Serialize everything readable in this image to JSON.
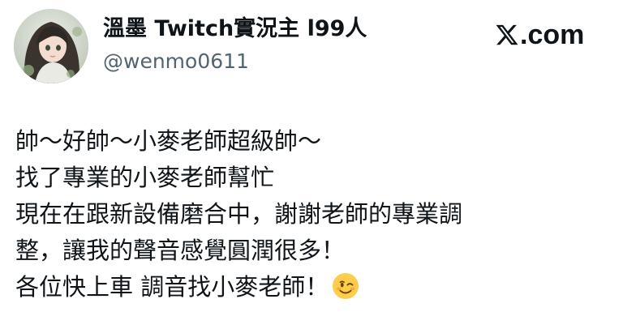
{
  "author": {
    "display_name": "溫墨 Twitch實況主 l99人",
    "handle": "@wenmo0611",
    "avatar_icon": "avatar-illustration"
  },
  "brand": {
    "logo_icon": "x-logo-icon",
    "text": ".com"
  },
  "tweet": {
    "lines": [
      "帥～好帥～小麥老師超級帥～",
      "找了專業的小麥老師幫忙",
      "現在在跟新設備磨合中，謝謝老師的專業調",
      "整，讓我的聲音感覺圓潤很多！",
      "各位快上車 調音找小麥老師！"
    ],
    "trailing_emoji": "winking-face-emoji"
  },
  "colors": {
    "text_primary": "#0f1419",
    "text_secondary": "#536471",
    "background": "#ffffff"
  }
}
